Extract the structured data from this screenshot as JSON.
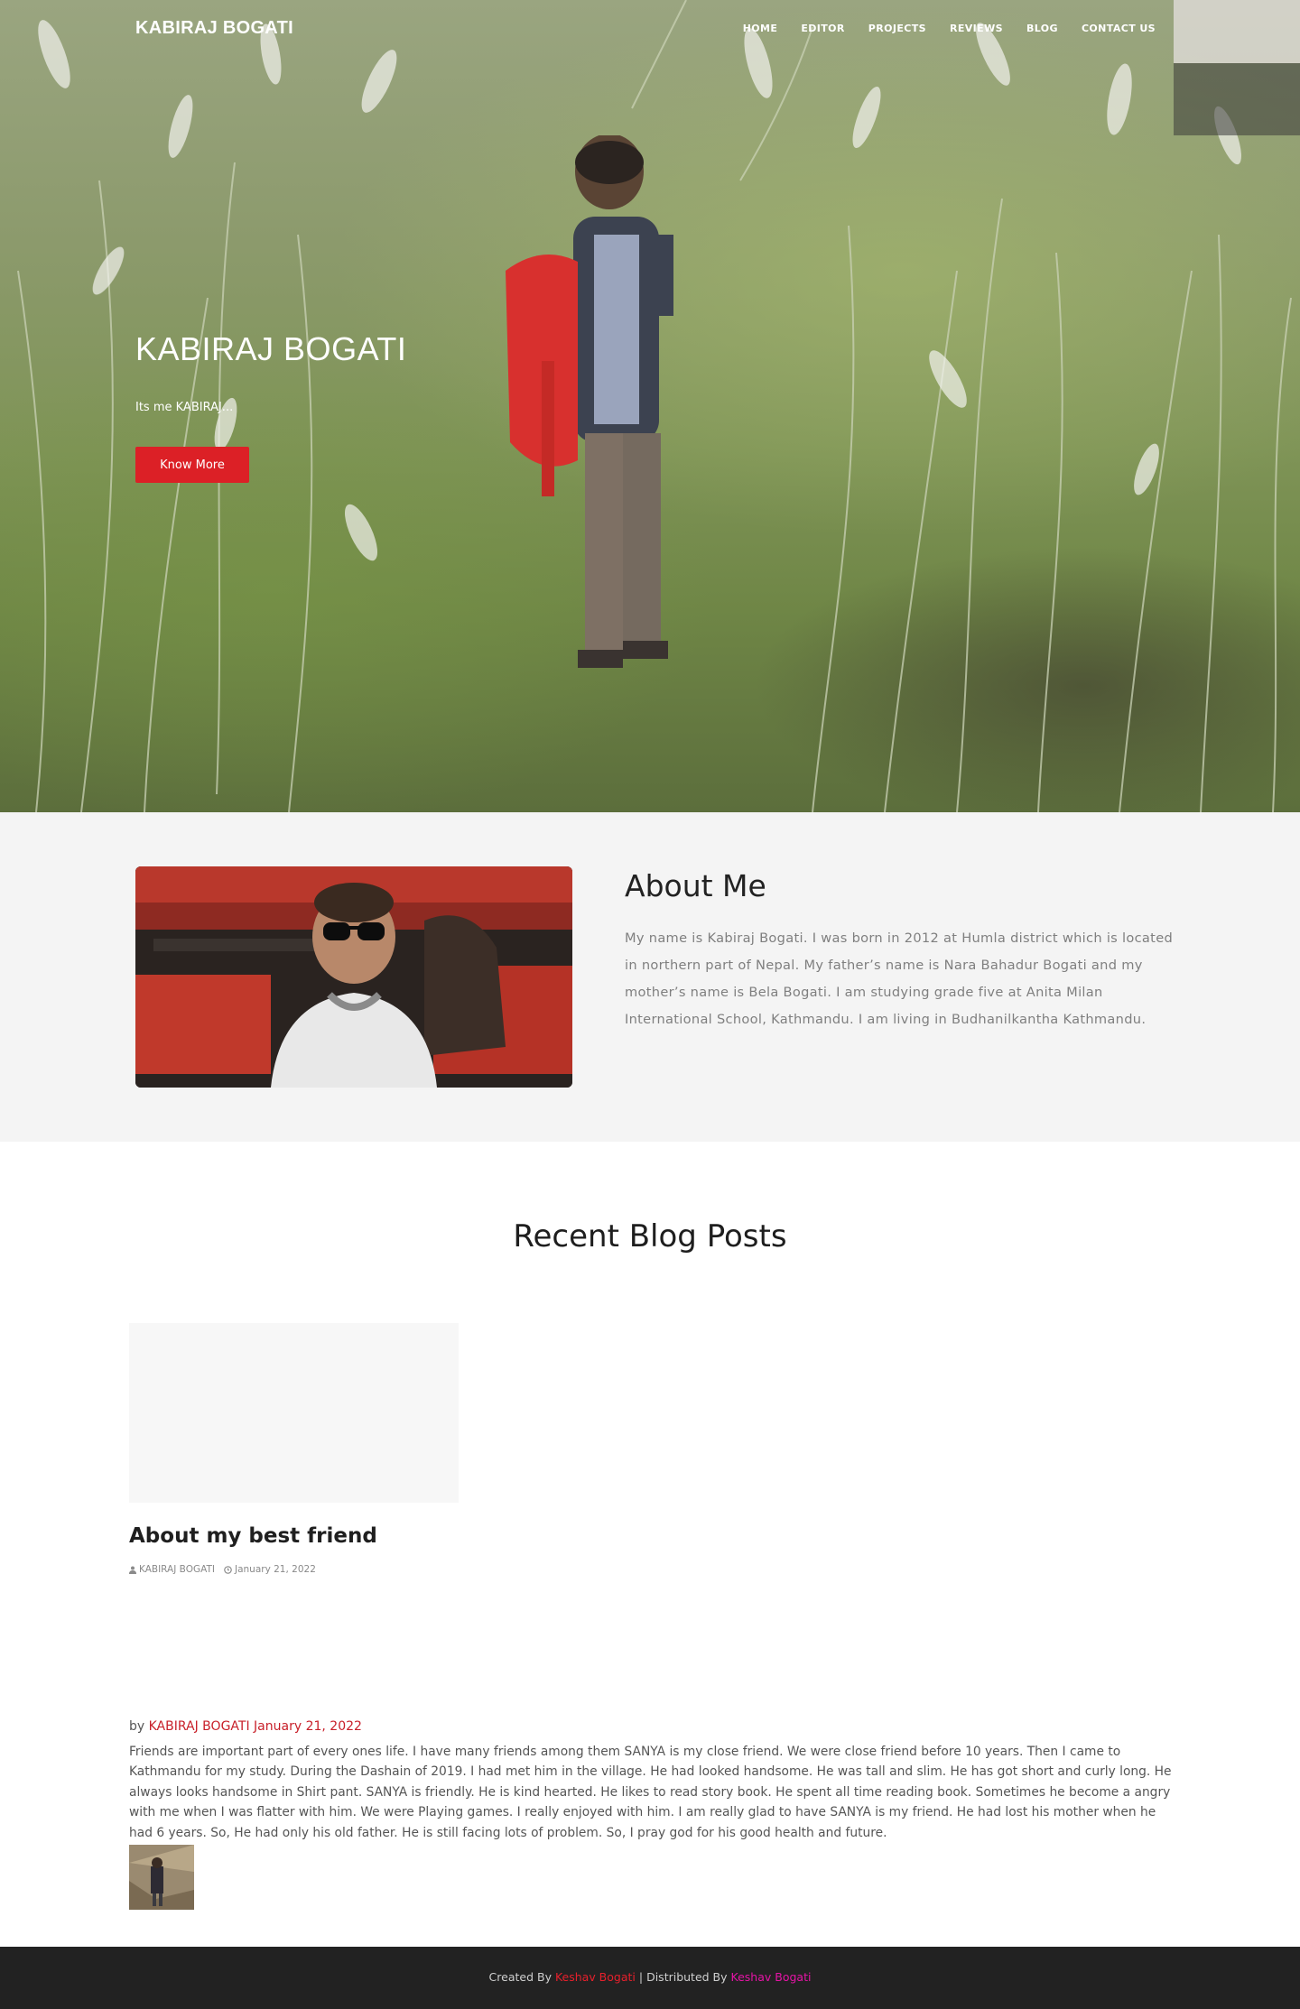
{
  "nav": {
    "brand": "KABIRAJ BOGATI",
    "items": [
      "HOME",
      "EDITOR",
      "PROJECTS",
      "REVIEWS",
      "BLOG",
      "CONTACT US"
    ]
  },
  "hero": {
    "title": "KABIRAJ BOGATI",
    "subtitle": "Its me KABIRAJ...",
    "button": "Know More"
  },
  "about": {
    "title": "About Me",
    "text": "My name is Kabiraj Bogati. I was born in 2012 at Humla district which is located in northern part of Nepal. My father’s name is Nara Bahadur Bogati and my mother’s name is Bela Bogati. I am studying grade five at Anita Milan International School, Kathmandu. I am living in Budhanilkantha Kathmandu."
  },
  "blog": {
    "heading": "Recent Blog Posts",
    "card": {
      "title": "About my best friend",
      "author": "KABIRAJ BOGATI",
      "date": "January 21, 2022"
    },
    "post": {
      "by_label": "by",
      "author": "KABIRAJ BOGATI",
      "date": "January 21, 2022",
      "text": "Friends are important part of every ones life. I have many friends among them SANYA is my close friend. We were close friend before 10 years. Then I came to Kathmandu for my study. During the Dashain of 2019. I had  met him in the village. He had looked handsome. He was tall and slim. He has got short and curly long. He always looks handsome in Shirt pant. SANYA is friendly. He is kind hearted. He likes to read story book. He spent all time reading book. Sometimes he become a angry with me when I was flatter with him. We were Playing games. I really enjoyed with him. I am really glad to have SANYA is my friend. He had lost his mother when he had 6 years. So, He had only his old father. He is still facing lots of problem. So, I pray  god for his good health and future."
    }
  },
  "footer": {
    "created_label": "Created By",
    "created_name": "Keshav Bogati",
    "separator": "|",
    "distributed_label": "Distributed By",
    "distributed_name": "Keshav Bogati"
  },
  "colors": {
    "accent_red": "#dc2026",
    "link_pink": "#e514a5",
    "footer_bg": "#222222",
    "about_bg": "#f4f4f4"
  }
}
